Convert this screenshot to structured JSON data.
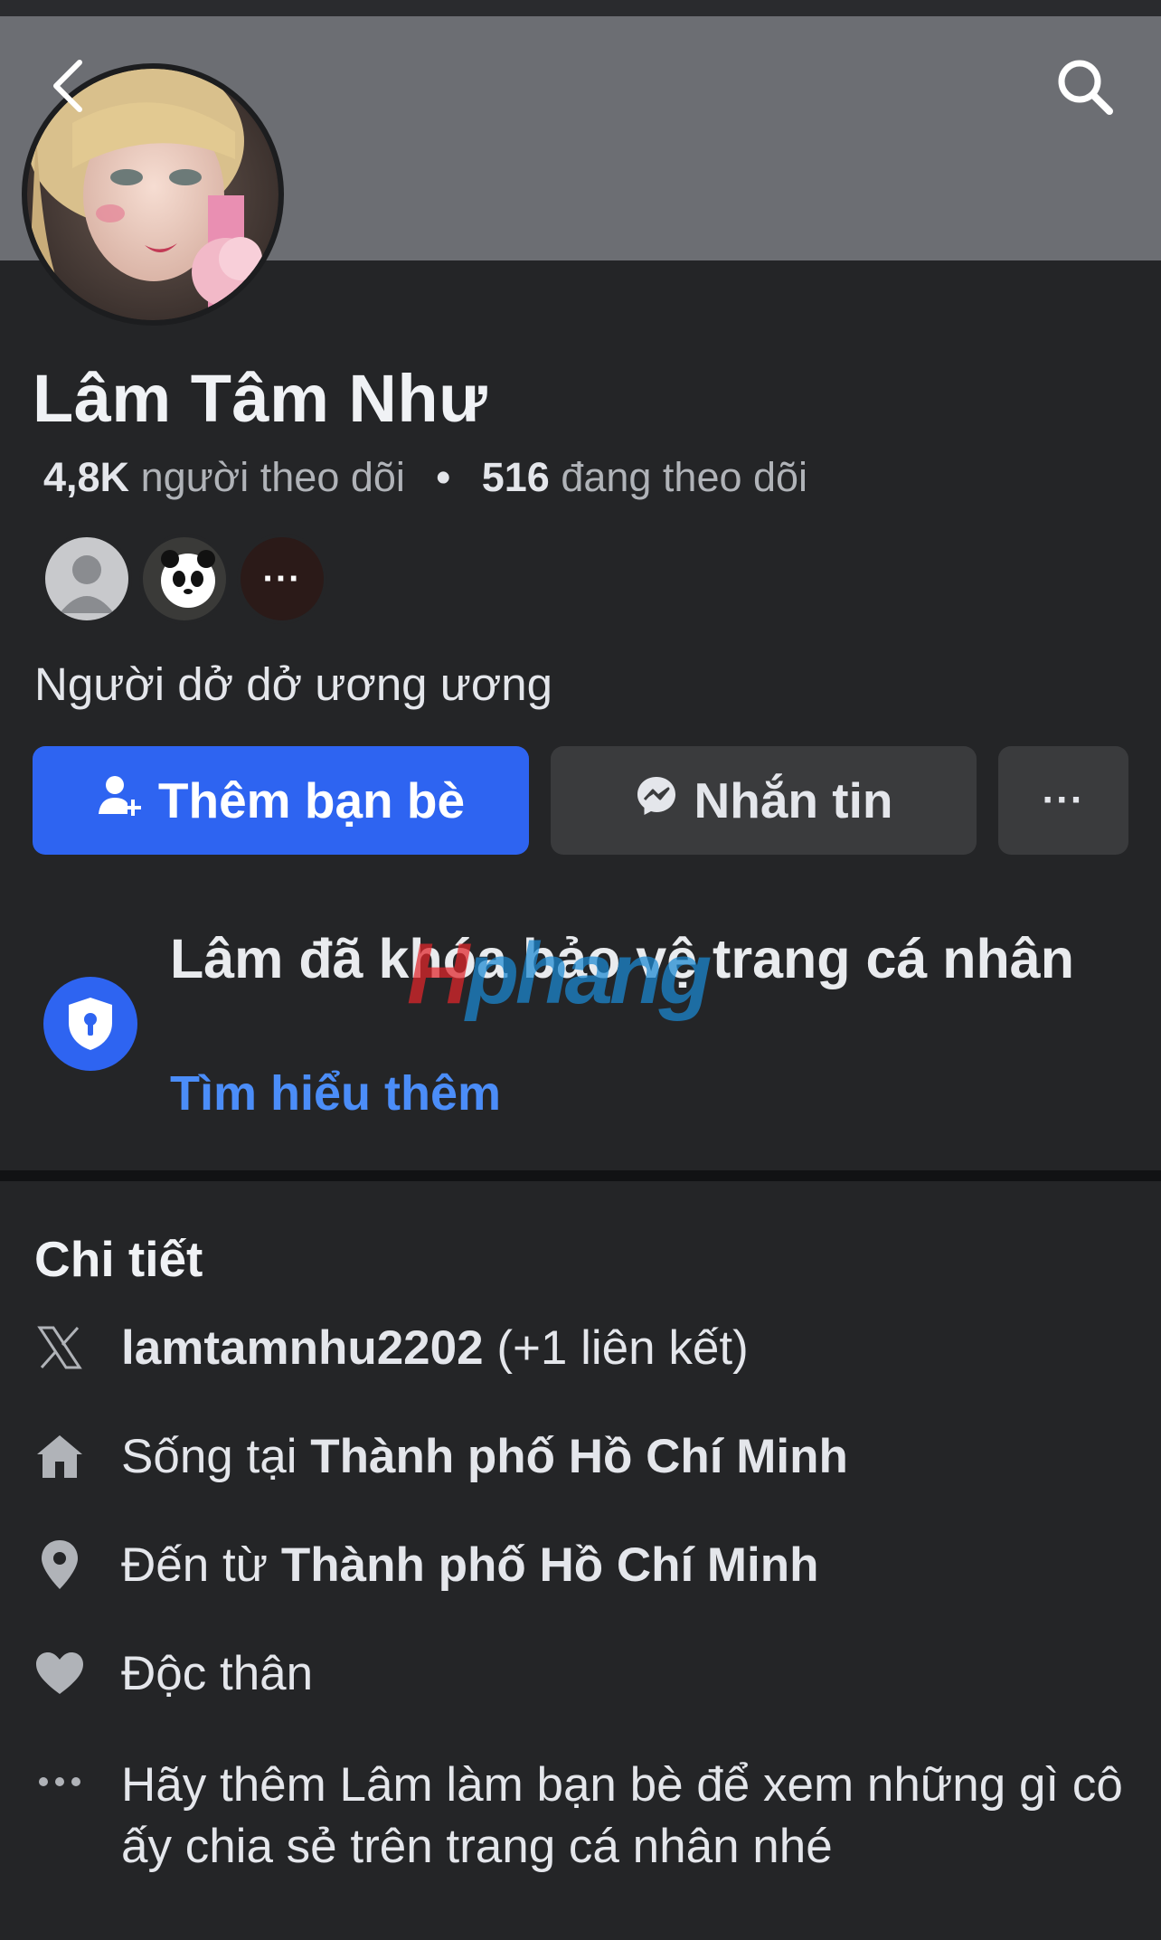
{
  "profile": {
    "name": "Lâm Tâm Như",
    "followers_count": "4,8K",
    "followers_label": "người theo dõi",
    "following_count": "516",
    "following_label": "đang theo dõi",
    "bio": "Người dở dở ương ương",
    "mutual_more": "···"
  },
  "actions": {
    "add_friend": "Thêm bạn bè",
    "message": "Nhắn tin",
    "more": "···"
  },
  "lock_notice": {
    "text": "Lâm đã khóa bảo vệ trang cá nhân",
    "link": "Tìm hiểu thêm"
  },
  "watermark": {
    "part1": "H",
    "part2": "phang"
  },
  "details": {
    "title": "Chi tiết",
    "social": "lamtamnhu2202",
    "social_extra": " (+1 liên kết)",
    "lives_prefix": "Sống tại ",
    "lives_place": "Thành phố Hồ Chí Minh",
    "from_prefix": "Đến từ ",
    "from_place": "Thành phố Hồ Chí Minh",
    "relationship": "Độc thân",
    "add_friend_hint": "Hãy thêm Lâm làm bạn bè để xem những gì cô ấy chia sẻ trên trang cá nhân nhé"
  },
  "colors": {
    "primary_blue": "#2e64f1",
    "link_blue": "#4b8df8",
    "background": "#242527",
    "cover": "#6c6e73",
    "button_gray": "#3a3b3d"
  },
  "icons": [
    "back-arrow-icon",
    "search-icon",
    "add-friend-icon",
    "messenger-icon",
    "more-icon",
    "shield-lock-icon",
    "x-logo-icon",
    "home-icon",
    "location-pin-icon",
    "heart-icon",
    "ellipsis-icon"
  ]
}
